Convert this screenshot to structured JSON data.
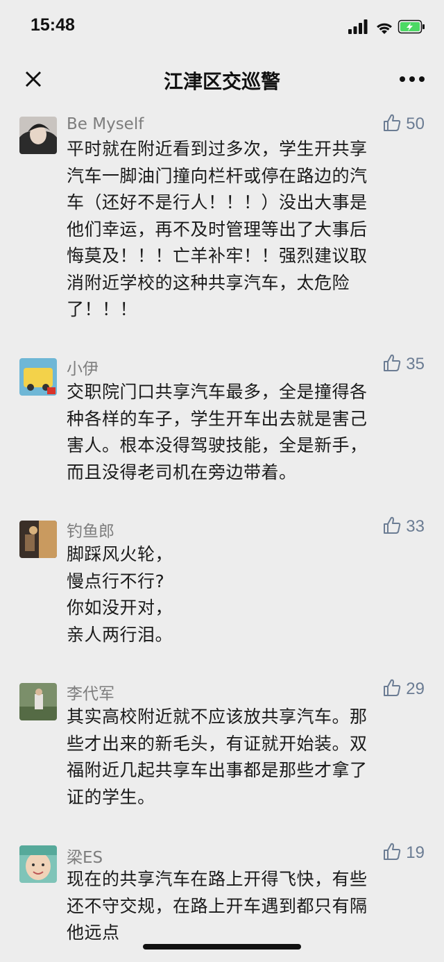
{
  "status_bar": {
    "time": "15:48"
  },
  "nav": {
    "title": "江津区交巡警"
  },
  "comments": [
    {
      "username": "Be Myself",
      "likes": "50",
      "text": "平时就在附近看到过多次，学生开共享\n汽车一脚油门撞向栏杆或停在路边的汽\n车（还好不是行人！！！）没出大事是\n他们幸运，再不及时管理等出了大事后\n悔莫及！！！亡羊补牢！！强烈建议取\n消附近学校的这种共享汽车，太危险\n了！！！"
    },
    {
      "username": "小伊",
      "likes": "35",
      "text": "交职院门口共享汽车最多，全是撞得各\n种各样的车子，学生开车出去就是害己\n害人。根本没得驾驶技能，全是新手，\n而且没得老司机在旁边带着。"
    },
    {
      "username": "钓鱼郎",
      "likes": "33",
      "text": "脚踩风火轮，\n慢点行不行?\n你如没开对，\n亲人两行泪。"
    },
    {
      "username": "李代军",
      "likes": "29",
      "text": "其实高校附近就不应该放共享汽车。那\n些才出来的新毛头，有证就开始装。双\n福附近几起共享车出事都是那些才拿了\n证的学生。"
    },
    {
      "username": "梁ES",
      "likes": "19",
      "text": "现在的共享汽车在路上开得飞快，有些\n还不守交规，在路上开车遇到都只有隔\n他远点"
    }
  ]
}
